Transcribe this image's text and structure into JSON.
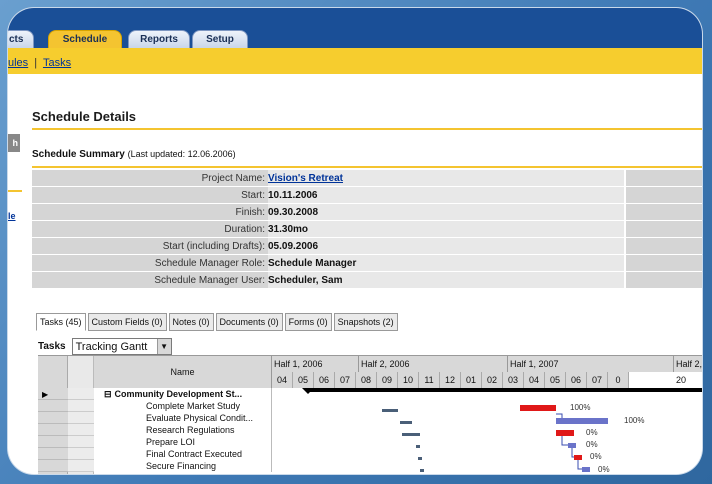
{
  "top_tabs": {
    "partial": "cts",
    "schedule": "Schedule",
    "reports": "Reports",
    "setup": "Setup"
  },
  "subnav": {
    "partial_link": "ules",
    "separator": "|",
    "tasks_link": "Tasks"
  },
  "left_partial": {
    "grey_label": "h",
    "link": "le"
  },
  "page": {
    "title": "Schedule Details",
    "summary_title": "Schedule Summary",
    "summary_updated": "(Last updated: 12.06.2006)"
  },
  "summary": {
    "rows": [
      {
        "label": "Project Name:",
        "value": "Vision's Retreat",
        "is_link": true
      },
      {
        "label": "Start:",
        "value": "10.11.2006"
      },
      {
        "label": "Finish:",
        "value": "09.30.2008"
      },
      {
        "label": "Duration:",
        "value": "31.30mo"
      },
      {
        "label": "Start (including Drafts):",
        "value": "05.09.2006"
      },
      {
        "label": "Schedule Manager Role:",
        "value": "Schedule Manager"
      },
      {
        "label": "Schedule Manager User:",
        "value": "Scheduler, Sam"
      }
    ]
  },
  "detail_tabs": [
    {
      "label": "Tasks (45)",
      "active": true
    },
    {
      "label": "Custom Fields (0)"
    },
    {
      "label": "Notes (0)"
    },
    {
      "label": "Documents (0)"
    },
    {
      "label": "Forms (0)"
    },
    {
      "label": "Snapshots (2)"
    }
  ],
  "tasks_view": {
    "label": "Tasks",
    "selected_view": "Tracking Gantt"
  },
  "gantt": {
    "name_header": "Name",
    "halves": [
      "Half 1, 2006",
      "Half 2, 2006",
      "Half 1, 2007",
      "Half 2, 20"
    ],
    "months": [
      "04",
      "05",
      "06",
      "07",
      "08",
      "09",
      "10",
      "11",
      "12",
      "01",
      "02",
      "03",
      "04",
      "05",
      "06",
      "07",
      "0"
    ],
    "rows": [
      {
        "name": "Community Development St...",
        "group": true,
        "collapse_symbol": "⊟"
      },
      {
        "name": "Complete Market Study",
        "pct": "100%"
      },
      {
        "name": "Evaluate Physical Condit...",
        "pct": "100%"
      },
      {
        "name": "Research Regulations",
        "pct": "0%"
      },
      {
        "name": "Prepare LOI",
        "pct": "0%"
      },
      {
        "name": "Final Contract Executed",
        "pct": "0%"
      },
      {
        "name": "Secure Financing",
        "pct": "0%"
      }
    ],
    "colors": {
      "baseline": "#4a5f78",
      "actual": "#e01818",
      "complete": "#6a73c9",
      "summary": "#000000"
    }
  },
  "colors": {
    "top_bar": "#1a4f97",
    "accent_yellow": "#f4c430",
    "link": "#003399"
  }
}
